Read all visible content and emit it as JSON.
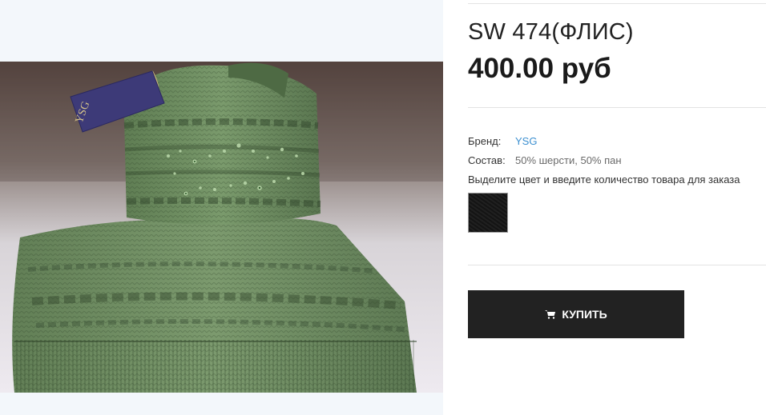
{
  "product": {
    "title": "SW 474(ФЛИС)",
    "price": "400.00 руб",
    "image_alt": "Зелёная вязаная шапка и шарф с этикеткой YSG"
  },
  "specs": {
    "brand_label": "Бренд:",
    "brand_value": "YSG",
    "composition_label": "Состав:",
    "composition_value": "50% шерсти, 50% пан"
  },
  "instruction": "Выделите цвет и введите количество товара для заказа",
  "color_options": [
    {
      "name": "black",
      "hex": "#141414"
    }
  ],
  "buy_button": {
    "label": "КУПИТЬ",
    "icon": "cart-icon"
  },
  "photo_tag_text": "YSG",
  "colors": {
    "button_bg": "#222222",
    "link": "#3b8fd0",
    "product_green": "#6f8f62"
  }
}
